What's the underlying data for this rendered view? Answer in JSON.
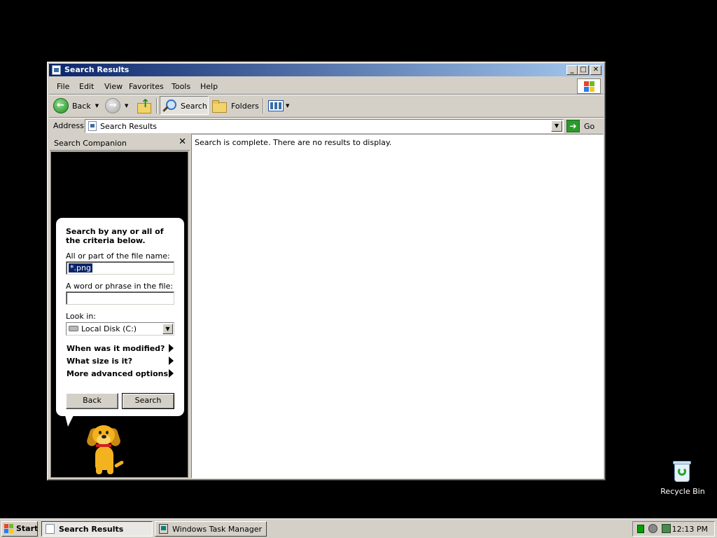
{
  "window": {
    "title": "Search Results",
    "menu": [
      "File",
      "Edit",
      "View",
      "Favorites",
      "Tools",
      "Help"
    ],
    "toolbar": {
      "back": "Back",
      "search": "Search",
      "folders": "Folders"
    },
    "address": {
      "label": "Address",
      "value": "Search Results",
      "go": "Go"
    }
  },
  "companion": {
    "title": "Search Companion",
    "intro": "Search by any or all of the criteria below.",
    "filename_label": "All or part of the file name:",
    "filename_value": "*.png",
    "phrase_label": "A word or phrase in the file:",
    "phrase_value": "",
    "lookin_label": "Look in:",
    "lookin_value": "Local Disk (C:)",
    "options": [
      "When was it modified?",
      "What size is it?",
      "More advanced options"
    ],
    "back_button": "Back",
    "search_button": "Search"
  },
  "results": {
    "message": "Search is complete. There are no results to display."
  },
  "desktop": {
    "recycle_bin": "Recycle Bin"
  },
  "taskbar": {
    "start": "Start",
    "tasks": [
      "Search Results",
      "Windows Task Manager"
    ],
    "clock": "12:13 PM"
  }
}
